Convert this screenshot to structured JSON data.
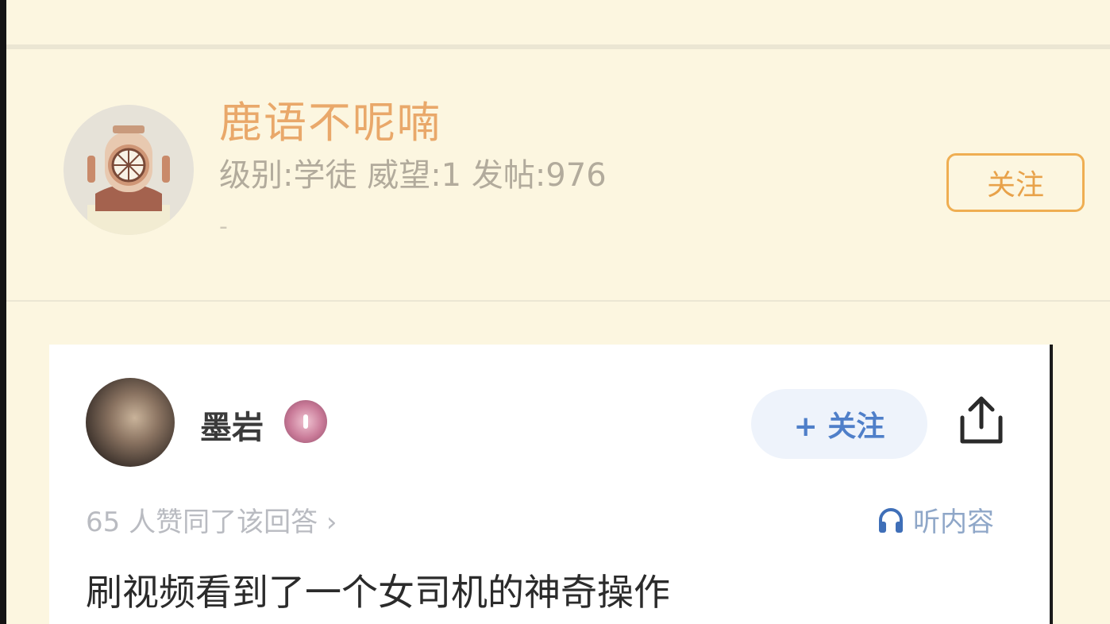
{
  "author": {
    "name": "鹿语不呢喃",
    "meta": "级别:学徒 威望:1 发帖:976",
    "signature": "-",
    "follow_label": "关注",
    "avatar_icon": "diving-helmet-avatar"
  },
  "quoted_card": {
    "user_name": "墨岩",
    "badge_icon": "user-badge-icon",
    "follow_label": "+ 关注",
    "share_icon": "share-icon",
    "likes_text": "65 人赞同了该回答 ›",
    "listen_label": "听内容",
    "listen_icon": "headphones-icon",
    "answer_text": "刷视频看到了一个女司机的神奇操作"
  },
  "colors": {
    "page_bg": "#fcf6e0",
    "name_accent": "#e9a86a",
    "follow_border": "#efae52",
    "card_follow_bg": "#eef3fb",
    "card_follow_text": "#4f7fc9"
  }
}
